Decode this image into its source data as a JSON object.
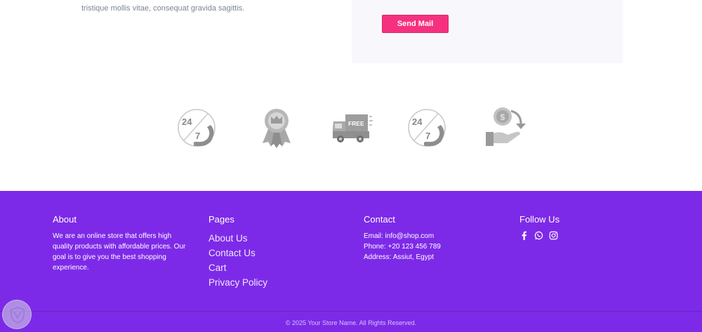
{
  "top": {
    "text": "tristique mollis vitae, consequat gravida sagittis.",
    "send_label": "Send Mail"
  },
  "features": [
    {
      "icon": "support-24-7-icon",
      "label1": "24",
      "label2": "7"
    },
    {
      "icon": "award-ribbon-icon"
    },
    {
      "icon": "free-delivery-truck-icon",
      "label": "FREE"
    },
    {
      "icon": "support-24-7-icon",
      "label1": "24",
      "label2": "7"
    },
    {
      "icon": "money-back-icon",
      "label": "$"
    }
  ],
  "footer": {
    "about": {
      "heading": "About",
      "text": "We are an online store that offers high quality products with affordable prices. Our goal is to give you the best shopping experience."
    },
    "pages": {
      "heading": "Pages",
      "links": [
        "About Us",
        "Contact Us",
        "Cart",
        "Privacy Policy"
      ]
    },
    "contact": {
      "heading": "Contact",
      "email": "Email: info@shop.com",
      "phone": "Phone: +20 123 456 789",
      "address": "Address: Assiut, Egypt"
    },
    "follow": {
      "heading": "Follow Us",
      "icons": [
        "facebook-icon",
        "whatsapp-icon",
        "instagram-icon"
      ]
    },
    "copyright": "© 2025 Your Store Name. All Rights Reserved."
  },
  "colors": {
    "footer_bg": "#7d2ae8",
    "button_bg": "#f5317f",
    "icon_gray": "#9e9e9e"
  }
}
